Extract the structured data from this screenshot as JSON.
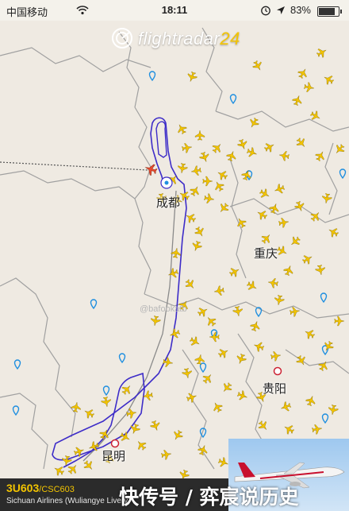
{
  "status_bar": {
    "carrier": "中国移动",
    "time": "18:11",
    "battery": "83%"
  },
  "brand": {
    "name": "flightradar",
    "suffix": "24"
  },
  "cities": {
    "chengdu": "成都",
    "chongqing": "重庆",
    "kunming": "昆明",
    "guiyang": "贵阳"
  },
  "watermark": "@bafookatb",
  "flight": {
    "number": "3U603",
    "callsign": "/CSC603",
    "airline": "Sichuan Airlines (Wuliangye Livery)"
  },
  "overlay_text": "快传号 / 弈宸说历史",
  "colors": {
    "map_bg": "#efeae2",
    "border": "#a0a0a0",
    "flight_path": "#3d2cc8",
    "planned_route": "#8a8a8a",
    "aircraft": "#f3c400",
    "selected_aircraft": "#e84a2e",
    "airport_pin": "#1f8fe0"
  },
  "icons": [
    "wifi-icon",
    "location-arrow-icon",
    "alarm-icon",
    "radar-logo-icon",
    "aircraft-icon",
    "airport-pin-icon",
    "selected-aircraft-icon"
  ]
}
